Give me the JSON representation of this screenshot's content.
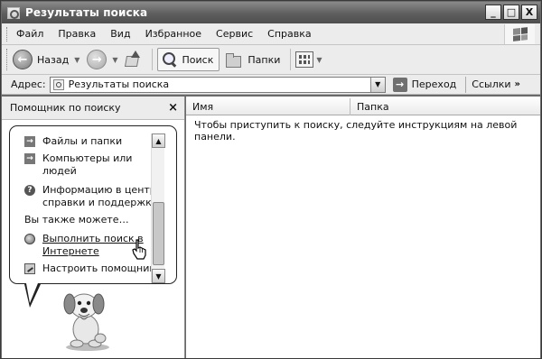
{
  "window": {
    "title": "Результаты поиска"
  },
  "title_buttons": {
    "minimize": "_",
    "maximize": "□",
    "close": "X"
  },
  "menu": {
    "items": [
      "Файл",
      "Правка",
      "Вид",
      "Избранное",
      "Сервис",
      "Справка"
    ]
  },
  "toolbar": {
    "back_label": "Назад",
    "search_label": "Поиск",
    "folders_label": "Папки"
  },
  "address": {
    "label": "Адрес:",
    "value": "Результаты поиска",
    "go_label": "Переход",
    "links_label": "Ссылки"
  },
  "search_pane": {
    "title": "Помощник по поиску",
    "close_glyph": "×",
    "items": [
      {
        "label": "Файлы и папки",
        "icon": "arrow-icon"
      },
      {
        "label": "Компьютеры или людей",
        "line1": "Компьютеры или",
        "line2": "людей",
        "icon": "arrow-icon"
      },
      {
        "label": "Информацию в центре справки и поддержки",
        "line1": "Информацию в центре",
        "line2": "справки и поддержки",
        "icon": "help-icon"
      }
    ],
    "also_text": "Вы также можете…",
    "links": [
      {
        "line1": "Выполнить поиск в",
        "line2": "Интернете",
        "icon": "globe-icon"
      },
      {
        "line1": "Настроить помощника",
        "icon": "wizard-icon"
      }
    ]
  },
  "results": {
    "columns": [
      "Имя",
      "Папка"
    ],
    "empty_message": "Чтобы приступить к поиску, следуйте инструкциям на левой панели."
  }
}
